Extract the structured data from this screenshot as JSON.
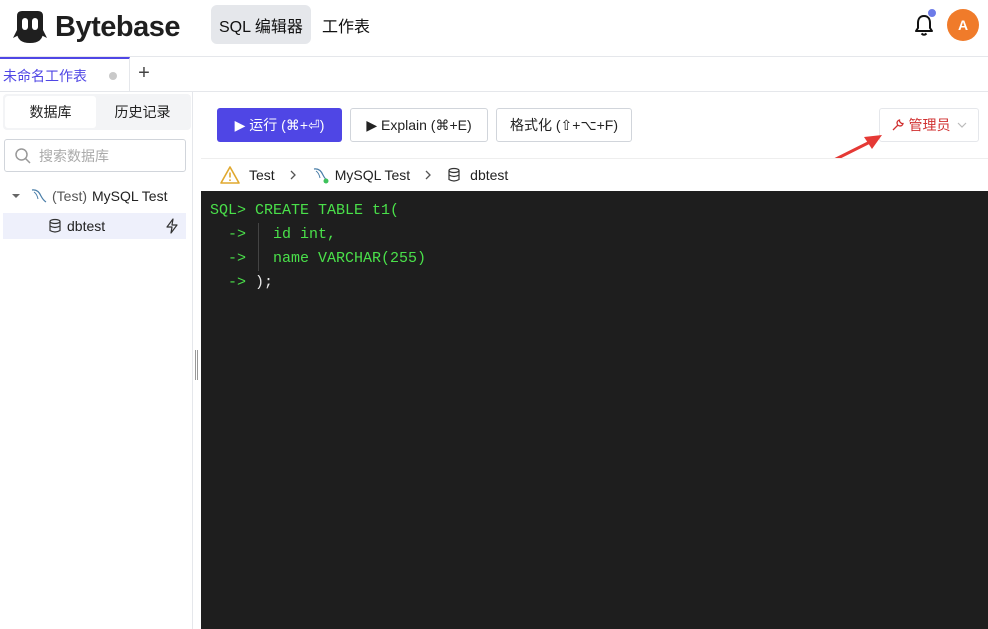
{
  "header": {
    "logo_text": "Bytebase",
    "nav": [
      {
        "label": "SQL 编辑器",
        "active": true
      },
      {
        "label": "工作表",
        "active": false
      }
    ],
    "avatar_initial": "A",
    "notification_dot_color": "#6d7be8"
  },
  "tabs": {
    "sheet_label": "未命名工作表",
    "add_label": "+"
  },
  "sidebar": {
    "tabs": [
      {
        "label": "数据库",
        "active": true
      },
      {
        "label": "历史记录",
        "active": false
      }
    ],
    "search_placeholder": "搜索数据库",
    "tree": {
      "instance_env": "(Test)",
      "instance_name": "MySQL Test",
      "database": "dbtest"
    }
  },
  "toolbar": {
    "run_label": "▶ 运行 (⌘+⏎)",
    "explain_label": "▶ Explain (⌘+E)",
    "format_label": "格式化 (⇧+⌥+F)",
    "admin_label": "管理员"
  },
  "breadcrumb": {
    "environment": "Test",
    "instance": "MySQL Test",
    "database": "dbtest"
  },
  "editor": {
    "prompt": "SQL>",
    "continuation": "->",
    "lines": [
      {
        "code": "CREATE TABLE t1("
      },
      {
        "code": "id int,"
      },
      {
        "code": "name VARCHAR(255)"
      },
      {
        "code": ");"
      }
    ]
  },
  "colors": {
    "accent": "#4f46e5",
    "admin_red": "#d03030",
    "editor_bg": "#1e1e1e",
    "sql_green": "#4ae04a",
    "avatar_bg": "#f07b2a",
    "annotation_arrow": "#e53935"
  }
}
